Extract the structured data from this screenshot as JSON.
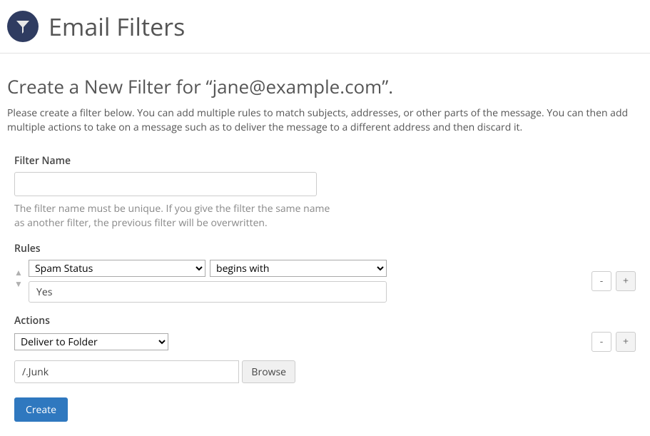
{
  "header": {
    "title": "Email Filters"
  },
  "subtitle": "Create a New Filter for “jane@example.com”.",
  "description": "Please create a filter below. You can add multiple rules to match subjects, addresses, or other parts of the message. You can then add multiple actions to take on a message such as to deliver the message to a different address and then discard it.",
  "filter_name": {
    "label": "Filter Name",
    "value": "",
    "help": "The filter name must be unique. If you give the filter the same name as another filter, the previous filter will be overwritten."
  },
  "rules": {
    "label": "Rules",
    "items": [
      {
        "field": "Spam Status",
        "condition": "begins with",
        "value": "Yes"
      }
    ]
  },
  "actions": {
    "label": "Actions",
    "items": [
      {
        "type": "Deliver to Folder",
        "folder": "/.Junk"
      }
    ]
  },
  "buttons": {
    "minus": "-",
    "plus": "+",
    "browse": "Browse",
    "create": "Create"
  }
}
